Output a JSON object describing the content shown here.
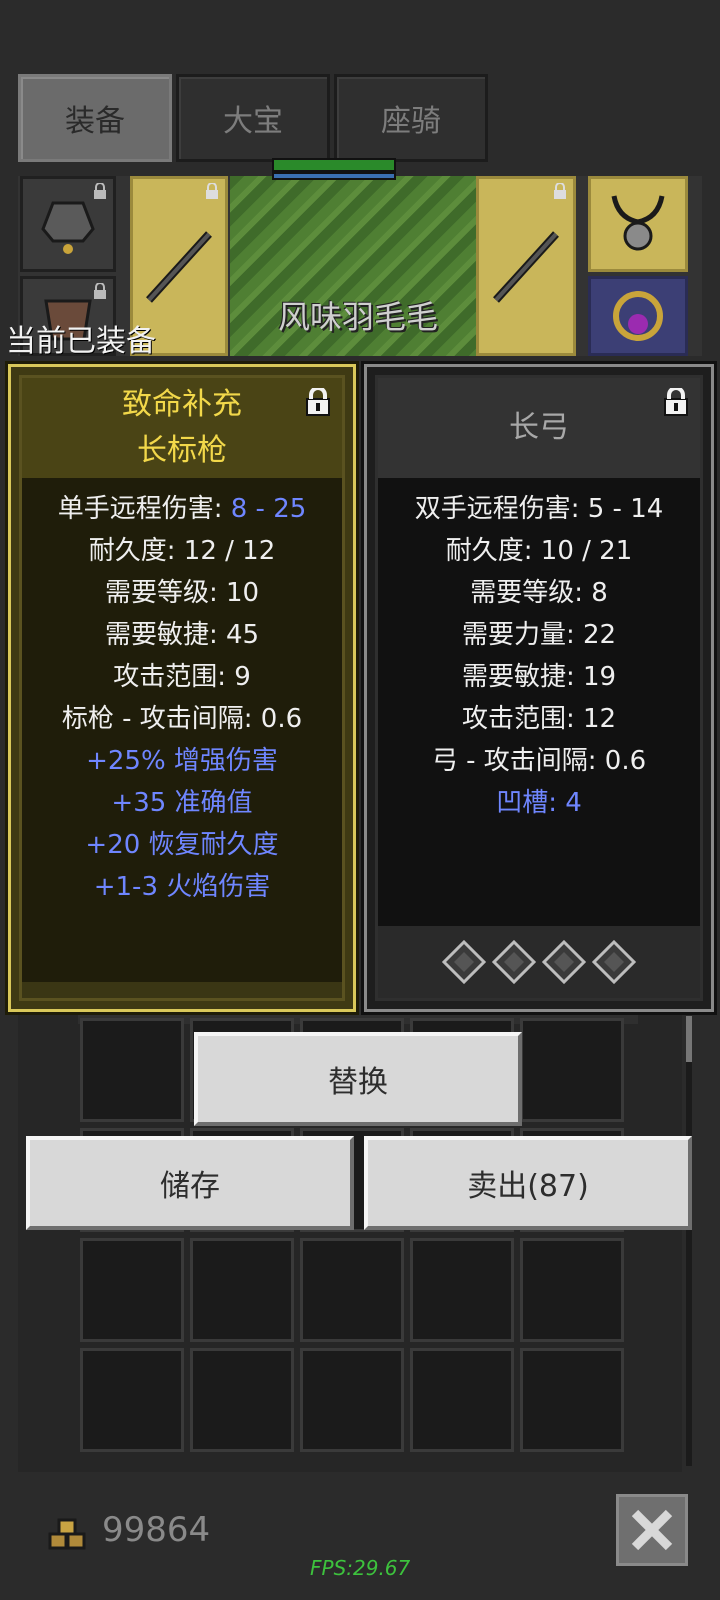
{
  "tabs": [
    {
      "label": "装备",
      "active": true
    },
    {
      "label": "大宝",
      "active": false
    },
    {
      "label": "座骑",
      "active": false
    }
  ],
  "scene": {
    "character_name": "风味羽毛毛"
  },
  "equipped_label": "当前已装备",
  "left_card": {
    "title_line1": "致命补充",
    "title_line2": "长标枪",
    "stat_damage_label": "单手远程伤害: ",
    "stat_damage_value": "8 - 25",
    "stats": [
      "耐久度: 12 / 12",
      "需要等级: 10",
      "需要敏捷: 45",
      "攻击范围: 9",
      "标枪 - 攻击间隔: 0.6"
    ],
    "affixes": [
      "+25% 增强伤害",
      "+35 准确值",
      "+20 恢复耐久度",
      "+1-3 火焰伤害"
    ],
    "locked": true
  },
  "right_card": {
    "title": "长弓",
    "stats": [
      "双手远程伤害: 5 - 14",
      "耐久度: 10 / 21",
      "需要等级: 8",
      "需要力量: 22",
      "需要敏捷: 19",
      "攻击范围: 12",
      "弓 - 攻击间隔: 0.6"
    ],
    "sockets_label": "凹槽: 4",
    "socket_count": 4,
    "locked": true
  },
  "buttons": {
    "replace": "替换",
    "store": "储存",
    "sell": "卖出(87)"
  },
  "footer": {
    "gold": "99864",
    "fps": "FPS:29.67"
  },
  "colors": {
    "accent_gold": "#d9c85a",
    "affix_blue": "#6f86ff",
    "fps_green": "#3dc23d"
  }
}
